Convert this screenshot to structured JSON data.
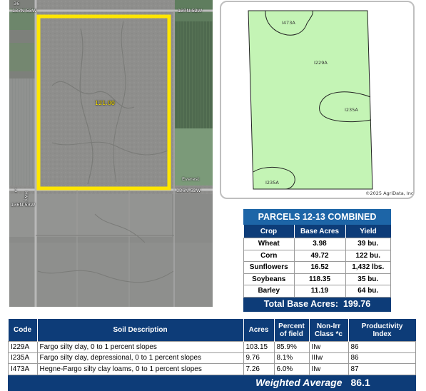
{
  "aerial_map": {
    "labels": {
      "road_top_left": "36",
      "road_top_left2": "137N-53W",
      "road_top_right": "137N-52W",
      "field_acres": "121.00",
      "town": "Everest",
      "road_mid_left": "1",
      "road_mid_label": "136N-52W",
      "road_vertical": "Hwy 5",
      "road_bottom_left": "136N-53W"
    },
    "colors": {
      "boundary": "#ffe600",
      "field": "#8e8e8c"
    }
  },
  "soil_map": {
    "labels": {
      "zone_1": "I473A",
      "zone_2": "I229A",
      "zone_3": "I235A",
      "zone_4": "I235A"
    },
    "copyright": "©2025 AgriData, Inc.",
    "colors": {
      "fill": "#c4f4b5"
    }
  },
  "parcels_table": {
    "title": "PARCELS 12-13 COMBINED",
    "headers": [
      "Crop",
      "Base Acres",
      "Yield"
    ],
    "rows": [
      {
        "crop": "Wheat",
        "base_acres": "3.98",
        "yield": "39 bu."
      },
      {
        "crop": "Corn",
        "base_acres": "49.72",
        "yield": "122 bu."
      },
      {
        "crop": "Sunflowers",
        "base_acres": "16.52",
        "yield": "1,432 lbs."
      },
      {
        "crop": "Soybeans",
        "base_acres": "118.35",
        "yield": "35 bu."
      },
      {
        "crop": "Barley",
        "base_acres": "11.19",
        "yield": "64 bu."
      }
    ],
    "total_label": "Total Base Acres:",
    "total_value": "199.76",
    "colors": {
      "title_bg": "#1d65a7",
      "header_bg": "#0d3c78"
    }
  },
  "soil_table": {
    "headers": {
      "code": "Code",
      "desc": "Soil Description",
      "acres": "Acres",
      "percent_line1": "Percent",
      "percent_line2": "of field",
      "class_line1": "Non-Irr",
      "class_line2": "Class *c",
      "prod_line1": "Productivity",
      "prod_line2": "Index"
    },
    "rows": [
      {
        "code": "I229A",
        "desc": "Fargo silty clay, 0 to 1 percent slopes",
        "acres": "103.15",
        "percent": "85.9%",
        "class": "IIw",
        "prod": "86"
      },
      {
        "code": "I235A",
        "desc": "Fargo silty clay, depressional, 0 to 1 percent slopes",
        "acres": "9.76",
        "percent": "8.1%",
        "class": "IIIw",
        "prod": "86"
      },
      {
        "code": "I473A",
        "desc": "Hegne-Fargo silty clay loams, 0 to 1 percent slopes",
        "acres": "7.26",
        "percent": "6.0%",
        "class": "IIw",
        "prod": "87"
      }
    ],
    "weighted_label": "Weighted Average",
    "weighted_value": "86.1"
  }
}
